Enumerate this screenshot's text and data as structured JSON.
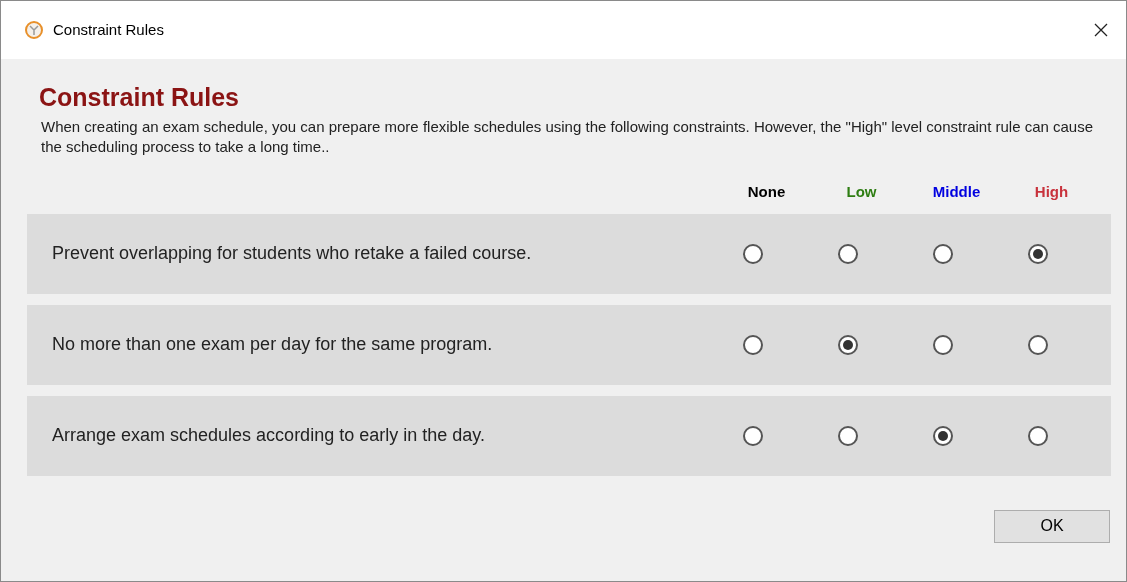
{
  "window": {
    "title": "Constraint Rules"
  },
  "heading": "Constraint Rules",
  "description": "When creating an exam schedule, you can prepare more flexible schedules using the following constraints. However, the \"High\" level constraint rule can cause the scheduling process to take a long time..",
  "levels": [
    {
      "label": "None",
      "color": "#000000"
    },
    {
      "label": "Low",
      "color": "#2e7d12"
    },
    {
      "label": "Middle",
      "color": "#0000e0"
    },
    {
      "label": "High",
      "color": "#c8323c"
    }
  ],
  "rules": [
    {
      "label": "Prevent overlapping for students who retake a failed course.",
      "options": [
        {
          "selected": false
        },
        {
          "selected": false
        },
        {
          "selected": false
        },
        {
          "selected": true
        }
      ]
    },
    {
      "label": "No more than one exam per day for the same program.",
      "options": [
        {
          "selected": false
        },
        {
          "selected": true
        },
        {
          "selected": false
        },
        {
          "selected": false
        }
      ]
    },
    {
      "label": "Arrange exam schedules according to early in the day.",
      "options": [
        {
          "selected": false
        },
        {
          "selected": false
        },
        {
          "selected": true
        },
        {
          "selected": false
        }
      ]
    }
  ],
  "buttons": [
    "OK"
  ]
}
